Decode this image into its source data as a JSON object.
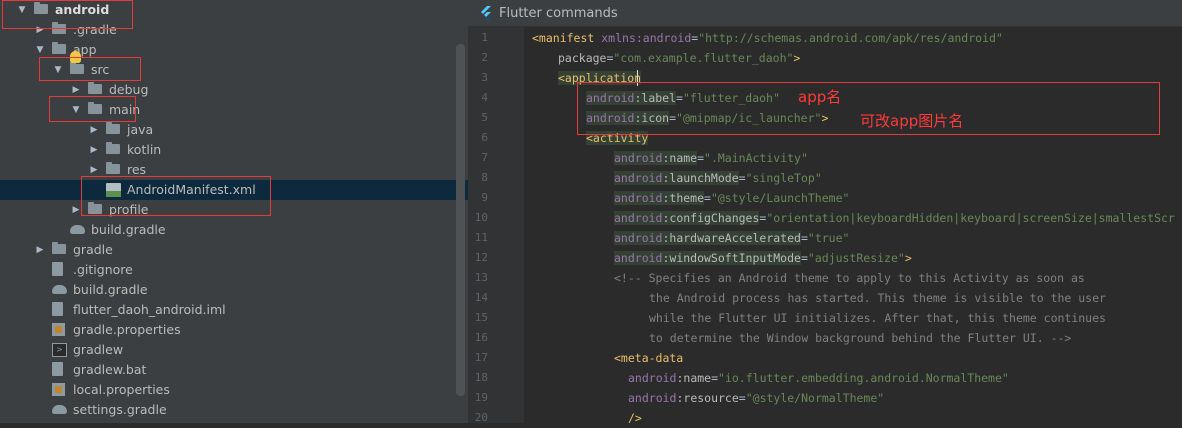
{
  "project_tree": {
    "items": [
      {
        "label": "android",
        "depth": 0,
        "arrow": "down",
        "icon": "folder-icon",
        "bold": true
      },
      {
        "label": ".gradle",
        "depth": 1,
        "arrow": "right",
        "icon": "folder-icon"
      },
      {
        "label": "app",
        "depth": 1,
        "arrow": "down",
        "icon": "folder-icon"
      },
      {
        "label": "src",
        "depth": 2,
        "arrow": "down",
        "icon": "folder-icon"
      },
      {
        "label": "debug",
        "depth": 3,
        "arrow": "right",
        "icon": "folder-icon"
      },
      {
        "label": "main",
        "depth": 3,
        "arrow": "down",
        "icon": "folder-icon"
      },
      {
        "label": "java",
        "depth": 4,
        "arrow": "right",
        "icon": "folder-icon"
      },
      {
        "label": "kotlin",
        "depth": 4,
        "arrow": "right",
        "icon": "folder-icon"
      },
      {
        "label": "res",
        "depth": 4,
        "arrow": "right",
        "icon": "folder-icon"
      },
      {
        "label": "AndroidManifest.xml",
        "depth": 4,
        "arrow": "none",
        "icon": "xml-file-icon",
        "selected": true
      },
      {
        "label": "profile",
        "depth": 3,
        "arrow": "right",
        "icon": "folder-icon"
      },
      {
        "label": "build.gradle",
        "depth": 2,
        "arrow": "none",
        "icon": "gradle-icon"
      },
      {
        "label": "gradle",
        "depth": 1,
        "arrow": "right",
        "icon": "folder-icon"
      },
      {
        "label": ".gitignore",
        "depth": 1,
        "arrow": "none",
        "icon": "file-icon"
      },
      {
        "label": "build.gradle",
        "depth": 1,
        "arrow": "none",
        "icon": "gradle-icon"
      },
      {
        "label": "flutter_daoh_android.iml",
        "depth": 1,
        "arrow": "none",
        "icon": "file-icon"
      },
      {
        "label": "gradle.properties",
        "depth": 1,
        "arrow": "none",
        "icon": "properties-icon"
      },
      {
        "label": "gradlew",
        "depth": 1,
        "arrow": "none",
        "icon": "terminal-file-icon"
      },
      {
        "label": "gradlew.bat",
        "depth": 1,
        "arrow": "none",
        "icon": "file-icon"
      },
      {
        "label": "local.properties",
        "depth": 1,
        "arrow": "none",
        "icon": "properties-icon"
      },
      {
        "label": "settings.gradle",
        "depth": 1,
        "arrow": "none",
        "icon": "gradle-icon"
      }
    ]
  },
  "editor": {
    "header_title": "Flutter commands",
    "header_icon": "flutter-icon",
    "lines": [
      {
        "n": "1",
        "indent": 0,
        "tokens": [
          [
            "t",
            "<manifest "
          ],
          [
            "ns",
            "xmlns:android"
          ],
          [
            "plain",
            "="
          ],
          [
            "str",
            "\"http://schemas.android.com/apk/res/android\""
          ]
        ]
      },
      {
        "n": "2",
        "indent": 1,
        "tokens": [
          [
            "attr",
            "package"
          ],
          [
            "plain",
            "="
          ],
          [
            "str",
            "\"com.example.flutter_daoh\""
          ],
          [
            "t",
            ">"
          ]
        ]
      },
      {
        "n": "3",
        "indent": 1,
        "tokens": [
          [
            "t",
            "<application"
          ]
        ]
      },
      {
        "n": "4",
        "indent": 2,
        "tokens": [
          [
            "ns",
            "android"
          ],
          [
            "attr",
            ":label"
          ],
          [
            "plain",
            "="
          ],
          [
            "str",
            "\"flutter_daoh\""
          ]
        ]
      },
      {
        "n": "5",
        "indent": 2,
        "tokens": [
          [
            "ns",
            "android"
          ],
          [
            "attr",
            ":icon"
          ],
          [
            "plain",
            "="
          ],
          [
            "str",
            "\"@mipmap/ic_launcher\""
          ],
          [
            "t",
            ">"
          ]
        ]
      },
      {
        "n": "6",
        "indent": 2,
        "tokens": [
          [
            "t",
            "<activity"
          ]
        ]
      },
      {
        "n": "7",
        "indent": 3,
        "tokens": [
          [
            "ns",
            "android"
          ],
          [
            "attr",
            ":name"
          ],
          [
            "plain",
            "="
          ],
          [
            "str",
            "\".MainActivity\""
          ]
        ]
      },
      {
        "n": "8",
        "indent": 3,
        "tokens": [
          [
            "ns",
            "android"
          ],
          [
            "attr",
            ":launchMode"
          ],
          [
            "plain",
            "="
          ],
          [
            "str",
            "\"singleTop\""
          ]
        ]
      },
      {
        "n": "9",
        "indent": 3,
        "tokens": [
          [
            "ns",
            "android"
          ],
          [
            "attr",
            ":theme"
          ],
          [
            "plain",
            "="
          ],
          [
            "str",
            "\"@style/LaunchTheme\""
          ]
        ]
      },
      {
        "n": "10",
        "indent": 3,
        "tokens": [
          [
            "ns",
            "android"
          ],
          [
            "attr",
            ":configChanges"
          ],
          [
            "plain",
            "="
          ],
          [
            "str",
            "\"orientation|keyboardHidden|keyboard|screenSize|smallestScr"
          ]
        ]
      },
      {
        "n": "11",
        "indent": 3,
        "tokens": [
          [
            "ns",
            "android"
          ],
          [
            "attr",
            ":hardwareAccelerated"
          ],
          [
            "plain",
            "="
          ],
          [
            "str",
            "\"true\""
          ]
        ]
      },
      {
        "n": "12",
        "indent": 3,
        "tokens": [
          [
            "ns",
            "android"
          ],
          [
            "attr",
            ":windowSoftInputMode"
          ],
          [
            "plain",
            "="
          ],
          [
            "str",
            "\"adjustResize\""
          ],
          [
            "t",
            ">"
          ]
        ]
      },
      {
        "n": "13",
        "indent": 3,
        "tokens": [
          [
            "com",
            "<!-- Specifies an Android theme to apply to this Activity as soon as"
          ]
        ]
      },
      {
        "n": "14",
        "indent": 4,
        "tokens": [
          [
            "com",
            "the Android process has started. This theme is visible to the user"
          ]
        ]
      },
      {
        "n": "15",
        "indent": 4,
        "tokens": [
          [
            "com",
            "while the Flutter UI initializes. After that, this theme continues"
          ]
        ]
      },
      {
        "n": "16",
        "indent": 4,
        "tokens": [
          [
            "com",
            "to determine the Window background behind the Flutter UI. -->"
          ]
        ]
      },
      {
        "n": "17",
        "indent": 3,
        "tokens": [
          [
            "t",
            "<meta-data"
          ]
        ]
      },
      {
        "n": "18",
        "indent": 5,
        "tokens": [
          [
            "ns",
            "android"
          ],
          [
            "attr",
            ":name"
          ],
          [
            "plain",
            "="
          ],
          [
            "str",
            "\"io.flutter.embedding.android.NormalTheme\""
          ]
        ]
      },
      {
        "n": "19",
        "indent": 5,
        "tokens": [
          [
            "ns",
            "android"
          ],
          [
            "attr",
            ":resource"
          ],
          [
            "plain",
            "="
          ],
          [
            "str",
            "\"@style/NormalTheme\""
          ]
        ]
      },
      {
        "n": "20",
        "indent": 5,
        "tokens": [
          [
            "t",
            "/>"
          ]
        ]
      }
    ]
  },
  "annotations": {
    "app_name_note": "app名",
    "icon_note": "可改app图片名"
  },
  "colors": {
    "annotation": "#e33b3b",
    "tag": "#e8bf6a",
    "namespace": "#9876aa",
    "string": "#6a8759",
    "comment": "#808080",
    "selection": "#0d293e"
  }
}
